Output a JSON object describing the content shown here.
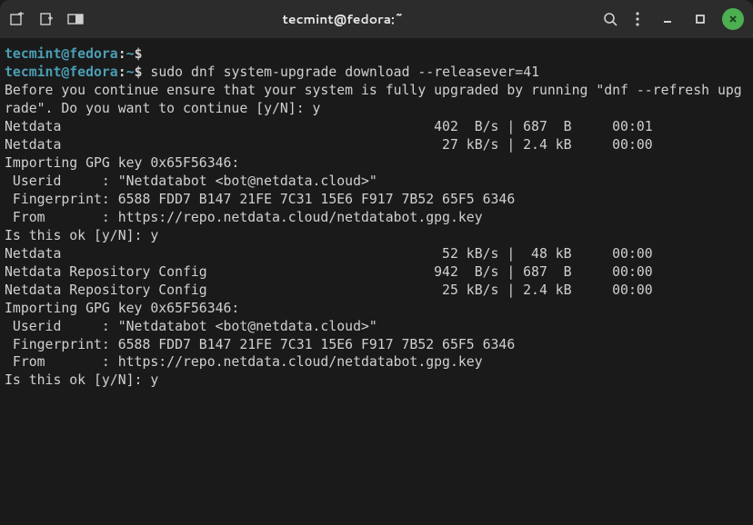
{
  "window": {
    "title": "tecmint@fedora:~"
  },
  "prompt": {
    "user_host": "tecmint@fedora",
    "sep": ":",
    "path": "~",
    "dollar": "$"
  },
  "lines": {
    "l0_prompt_only": "",
    "l1_cmd": "sudo dnf system-upgrade download --releasever=41",
    "l2": "Before you continue ensure that your system is fully upgraded by running \"dnf --refresh upg",
    "l3": "rade\". Do you want to continue [y/N]: y",
    "l4": "Netdata                                              402  B/s | 687  B     00:01",
    "l5": "Netdata                                               27 kB/s | 2.4 kB     00:00",
    "l6": "Importing GPG key 0x65F56346:",
    "l7": " Userid     : \"Netdatabot <bot@netdata.cloud>\"",
    "l8": " Fingerprint: 6588 FDD7 B147 21FE 7C31 15E6 F917 7B52 65F5 6346",
    "l9": " From       : https://repo.netdata.cloud/netdatabot.gpg.key",
    "l10": "Is this ok [y/N]: y",
    "l11": "Netdata                                               52 kB/s |  48 kB     00:00",
    "l12": "Netdata Repository Config                            942  B/s | 687  B     00:00",
    "l13": "Netdata Repository Config                             25 kB/s | 2.4 kB     00:00",
    "l14": "Importing GPG key 0x65F56346:",
    "l15": " Userid     : \"Netdatabot <bot@netdata.cloud>\"",
    "l16": " Fingerprint: 6588 FDD7 B147 21FE 7C31 15E6 F917 7B52 65F5 6346",
    "l17": " From       : https://repo.netdata.cloud/netdatabot.gpg.key",
    "l18": "Is this ok [y/N]: y"
  }
}
